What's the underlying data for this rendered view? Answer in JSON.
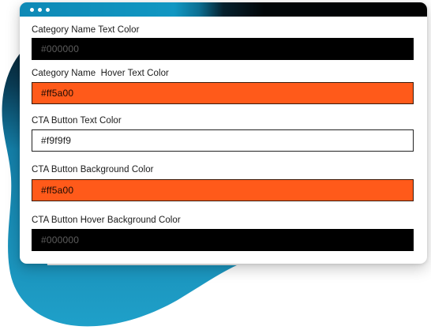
{
  "window": {
    "controls": [
      "dot",
      "dot",
      "dot"
    ]
  },
  "fields": [
    {
      "label": "Category Name Text Color",
      "value": "#000000",
      "swatch": "#000000"
    },
    {
      "label": "Category Name  Hover Text Color",
      "value": "#ff5a00",
      "swatch": "#ff5a00"
    },
    {
      "label": "CTA Button Text Color",
      "value": "#f9f9f9",
      "swatch": "#f9f9f9"
    },
    {
      "label": "CTA Button Background Color",
      "value": "#ff5a00",
      "swatch": "#ff5a00"
    },
    {
      "label": "CTA Button Hover Background Color",
      "value": "#000000",
      "swatch": "#000000"
    }
  ],
  "colors": {
    "blob_light": "#1b9cc4",
    "blob_dark": "#061a26",
    "accent_orange": "#ff5a00",
    "titlebar_start": "#1197c2",
    "titlebar_end": "#020202"
  }
}
